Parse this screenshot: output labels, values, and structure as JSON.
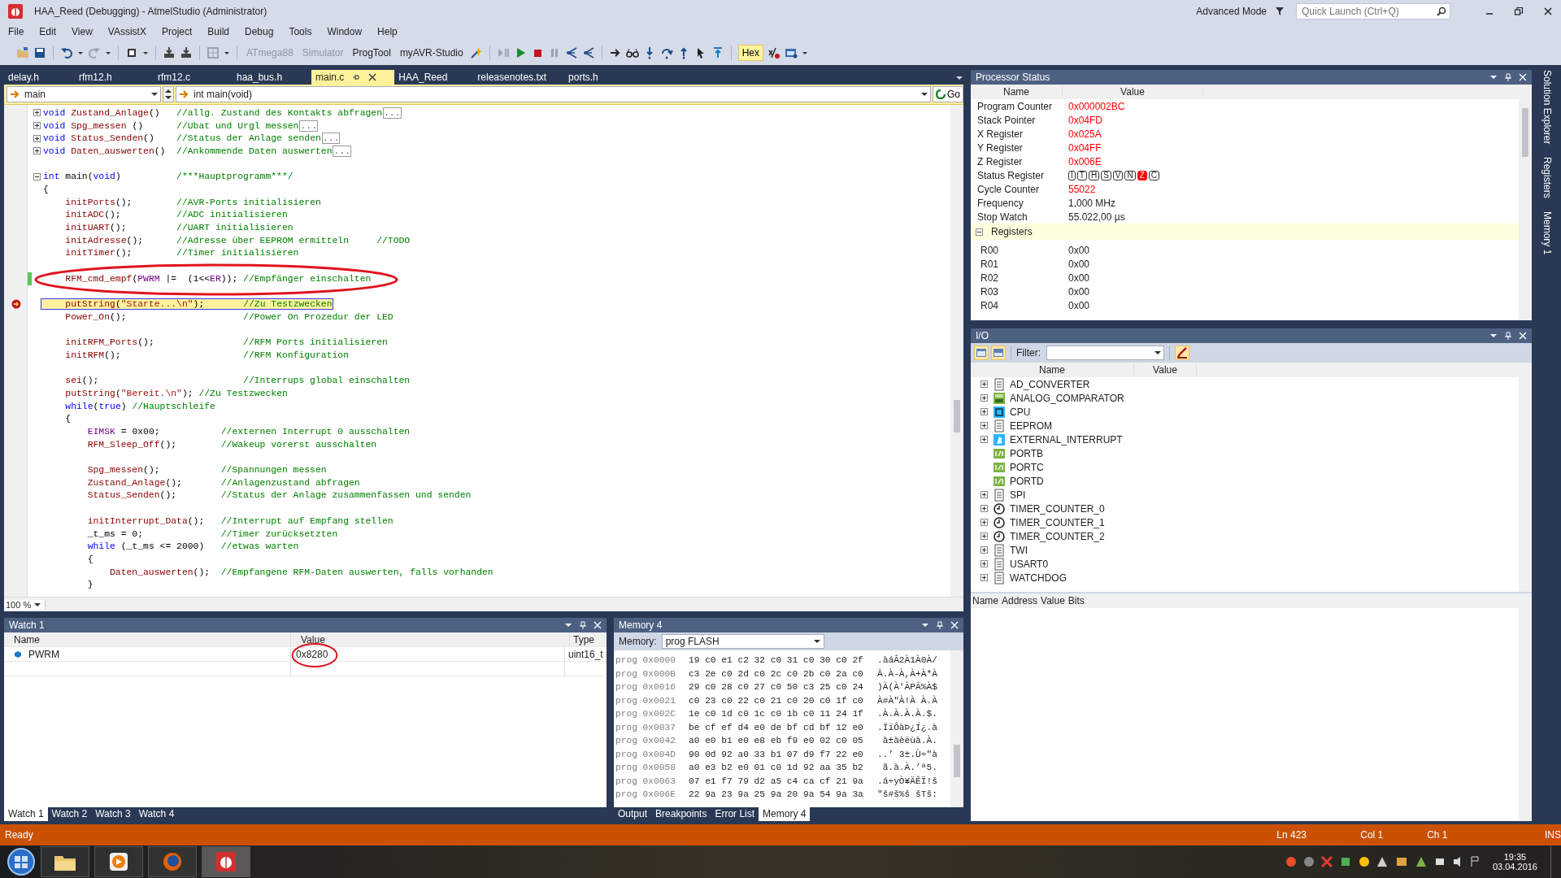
{
  "window": {
    "title": "HAA_Reed (Debugging) - AtmelStudio (Administrator)",
    "mode": "Advanced Mode",
    "quick_launch": {
      "placeholder": "Quick Launch (Ctrl+Q)"
    }
  },
  "menu": [
    "File",
    "Edit",
    "View",
    "VAssistX",
    "Project",
    "Build",
    "Debug",
    "Tools",
    "Window",
    "Help"
  ],
  "toolbar": [
    {
      "label": "ATmega88",
      "disabled": true
    },
    {
      "label": "Simulator",
      "disabled": true
    },
    {
      "label": "ProgTool",
      "disabled": false
    },
    {
      "label": "myAVR-Studio",
      "disabled": false
    }
  ],
  "hex_toggle": {
    "label": "Hex",
    "on": true
  },
  "editor": {
    "tabs": [
      {
        "label": "delay.h",
        "selected": false
      },
      {
        "label": "rfm12.h",
        "selected": false
      },
      {
        "label": "rfm12.c",
        "selected": false
      },
      {
        "label": "haa_bus.h",
        "selected": false
      },
      {
        "label": "main.c",
        "selected": true
      },
      {
        "label": "HAA_Reed",
        "selected": false
      },
      {
        "label": "releasenotes.txt",
        "selected": false
      },
      {
        "label": "ports.h",
        "selected": false
      }
    ],
    "scope": "main",
    "function": "int main(void)",
    "go": "Go",
    "zoom": "100 %",
    "lines": [
      {
        "kind": "collapsed",
        "tokens": [
          {
            "text": "void ",
            "kind": "keyword"
          },
          {
            "text": "Zustand_Anlage",
            "kind": "function"
          },
          {
            "text": "()   ",
            "kind": "plain"
          },
          {
            "text": "//allg. Zustand des Kontakts abfragen",
            "kind": "comment"
          },
          {
            "text": "...",
            "kind": "fold"
          }
        ]
      },
      {
        "kind": "collapsed",
        "tokens": [
          {
            "text": "void ",
            "kind": "keyword"
          },
          {
            "text": "Spg_messen",
            "kind": "function"
          },
          {
            "text": " ()      ",
            "kind": "plain"
          },
          {
            "text": "//Ubat und Urgl messen",
            "kind": "comment"
          },
          {
            "text": "...",
            "kind": "fold"
          }
        ]
      },
      {
        "kind": "collapsed",
        "tokens": [
          {
            "text": "void ",
            "kind": "keyword"
          },
          {
            "text": "Status_Senden",
            "kind": "function"
          },
          {
            "text": "()    ",
            "kind": "plain"
          },
          {
            "text": "//Status der Anlage senden",
            "kind": "comment"
          },
          {
            "text": "...",
            "kind": "fold"
          }
        ]
      },
      {
        "kind": "collapsed",
        "tokens": [
          {
            "text": "void ",
            "kind": "keyword"
          },
          {
            "text": "Daten_auswerten",
            "kind": "function"
          },
          {
            "text": "()  ",
            "kind": "plain"
          },
          {
            "text": "//Ankommende Daten auswerten",
            "kind": "comment"
          },
          {
            "text": "...",
            "kind": "fold"
          }
        ]
      },
      {
        "kind": "blank"
      },
      {
        "kind": "expanded",
        "tokens": [
          {
            "text": "int",
            "kind": "keyword"
          },
          {
            "text": " main(",
            "kind": "plain"
          },
          {
            "text": "void",
            "kind": "keyword"
          },
          {
            "text": ")          ",
            "kind": "plain"
          },
          {
            "text": "/***Hauptprogramm***/",
            "kind": "comment"
          }
        ]
      },
      {
        "kind": "code",
        "tokens": [
          {
            "text": "{",
            "kind": "plain"
          }
        ]
      },
      {
        "kind": "code",
        "tokens": [
          {
            "text": "    initPorts",
            "kind": "function"
          },
          {
            "text": "();        ",
            "kind": "plain"
          },
          {
            "text": "//AVR-Ports initialisieren",
            "kind": "comment"
          }
        ]
      },
      {
        "kind": "code",
        "tokens": [
          {
            "text": "    initADC",
            "kind": "function"
          },
          {
            "text": "();          ",
            "kind": "plain"
          },
          {
            "text": "//ADC initialisieren",
            "kind": "comment"
          }
        ]
      },
      {
        "kind": "code",
        "tokens": [
          {
            "text": "    initUART",
            "kind": "function"
          },
          {
            "text": "();         ",
            "kind": "plain"
          },
          {
            "text": "//UART initialisieren",
            "kind": "comment"
          }
        ]
      },
      {
        "kind": "code",
        "tokens": [
          {
            "text": "    initAdresse",
            "kind": "function"
          },
          {
            "text": "();      ",
            "kind": "plain"
          },
          {
            "text": "//Adresse über EEPROM ermitteln     //TODO",
            "kind": "comment"
          }
        ]
      },
      {
        "kind": "code",
        "tokens": [
          {
            "text": "    initTimer",
            "kind": "function"
          },
          {
            "text": "();        ",
            "kind": "plain"
          },
          {
            "text": "//Timer initialisieren",
            "kind": "comment"
          }
        ]
      },
      {
        "kind": "blank"
      },
      {
        "kind": "changed",
        "tokens": [
          {
            "text": "    RFM_cmd_empf",
            "kind": "function"
          },
          {
            "text": "(",
            "kind": "plain"
          },
          {
            "text": "PWRM",
            "kind": "macro"
          },
          {
            "text": " |=  (1<<",
            "kind": "plain"
          },
          {
            "text": "ER",
            "kind": "macro"
          },
          {
            "text": ")); ",
            "kind": "plain"
          },
          {
            "text": "//Empfänger einschalten",
            "kind": "comment"
          }
        ]
      },
      {
        "kind": "blank"
      },
      {
        "kind": "current",
        "tokens": [
          {
            "text": "    putString",
            "kind": "function"
          },
          {
            "text": "(",
            "kind": "plain"
          },
          {
            "text": "\"Starte...\\n\"",
            "kind": "string"
          },
          {
            "text": ");       ",
            "kind": "plain"
          },
          {
            "text": "//Zu Testzwecken",
            "kind": "comment"
          }
        ]
      },
      {
        "kind": "code",
        "tokens": [
          {
            "text": "    Power_On",
            "kind": "function"
          },
          {
            "text": "();                     ",
            "kind": "plain"
          },
          {
            "text": "//Power On Prozedur der LED",
            "kind": "comment"
          }
        ]
      },
      {
        "kind": "blank"
      },
      {
        "kind": "code",
        "tokens": [
          {
            "text": "    initRFM_Ports",
            "kind": "function"
          },
          {
            "text": "();                ",
            "kind": "plain"
          },
          {
            "text": "//RFM Ports initialisieren",
            "kind": "comment"
          }
        ]
      },
      {
        "kind": "code",
        "tokens": [
          {
            "text": "    initRFM",
            "kind": "function"
          },
          {
            "text": "();                      ",
            "kind": "plain"
          },
          {
            "text": "//RFM Konfiguration",
            "kind": "comment"
          }
        ]
      },
      {
        "kind": "blank"
      },
      {
        "kind": "code",
        "tokens": [
          {
            "text": "    sei",
            "kind": "function"
          },
          {
            "text": "();                          ",
            "kind": "plain"
          },
          {
            "text": "//Interrups global einschalten",
            "kind": "comment"
          }
        ]
      },
      {
        "kind": "code",
        "tokens": [
          {
            "text": "    putString",
            "kind": "function"
          },
          {
            "text": "(",
            "kind": "plain"
          },
          {
            "text": "\"Bereit.\\n\"",
            "kind": "string"
          },
          {
            "text": "); ",
            "kind": "plain"
          },
          {
            "text": "//Zu Testzwecken",
            "kind": "comment"
          }
        ]
      },
      {
        "kind": "code",
        "tokens": [
          {
            "text": "    while",
            "kind": "keyword"
          },
          {
            "text": "(",
            "kind": "plain"
          },
          {
            "text": "true",
            "kind": "keyword"
          },
          {
            "text": ") ",
            "kind": "plain"
          },
          {
            "text": "//Hauptschleife",
            "kind": "comment"
          }
        ]
      },
      {
        "kind": "code",
        "tokens": [
          {
            "text": "    {",
            "kind": "plain"
          }
        ]
      },
      {
        "kind": "code",
        "tokens": [
          {
            "text": "        EIMSK",
            "kind": "macro"
          },
          {
            "text": " = 0x00;           ",
            "kind": "plain"
          },
          {
            "text": "//externen Interrupt 0 ausschalten",
            "kind": "comment"
          }
        ]
      },
      {
        "kind": "code",
        "tokens": [
          {
            "text": "        RFM_Sleep_Off",
            "kind": "function"
          },
          {
            "text": "();        ",
            "kind": "plain"
          },
          {
            "text": "//Wakeup vorerst ausschalten",
            "kind": "comment"
          }
        ]
      },
      {
        "kind": "blank"
      },
      {
        "kind": "code",
        "tokens": [
          {
            "text": "        Spg_messen",
            "kind": "function"
          },
          {
            "text": "();           ",
            "kind": "plain"
          },
          {
            "text": "//Spannungen messen",
            "kind": "comment"
          }
        ]
      },
      {
        "kind": "code",
        "tokens": [
          {
            "text": "        Zustand_Anlage",
            "kind": "function"
          },
          {
            "text": "();       ",
            "kind": "plain"
          },
          {
            "text": "//Anlagenzustand abfragen",
            "kind": "comment"
          }
        ]
      },
      {
        "kind": "code",
        "tokens": [
          {
            "text": "        Status_Senden",
            "kind": "function"
          },
          {
            "text": "();        ",
            "kind": "plain"
          },
          {
            "text": "//Status der Anlage zusammenfassen und senden",
            "kind": "comment"
          }
        ]
      },
      {
        "kind": "blank"
      },
      {
        "kind": "code",
        "tokens": [
          {
            "text": "        initInterrupt_Data",
            "kind": "function"
          },
          {
            "text": "();   ",
            "kind": "plain"
          },
          {
            "text": "//Interrupt auf Empfang stellen",
            "kind": "comment"
          }
        ]
      },
      {
        "kind": "code",
        "tokens": [
          {
            "text": "        _t_ms = 0;              ",
            "kind": "plain"
          },
          {
            "text": "//Timer zurücksetzten",
            "kind": "comment"
          }
        ]
      },
      {
        "kind": "code",
        "tokens": [
          {
            "text": "        while",
            "kind": "keyword"
          },
          {
            "text": " (_t_ms <= 2000)   ",
            "kind": "plain"
          },
          {
            "text": "//etwas warten",
            "kind": "comment"
          }
        ]
      },
      {
        "kind": "code",
        "tokens": [
          {
            "text": "        {",
            "kind": "plain"
          }
        ]
      },
      {
        "kind": "code",
        "tokens": [
          {
            "text": "            Daten_auswerten",
            "kind": "function"
          },
          {
            "text": "();  ",
            "kind": "plain"
          },
          {
            "text": "//Empfangene RFM-Daten auswerten, falls vorhanden",
            "kind": "comment"
          }
        ]
      },
      {
        "kind": "code",
        "tokens": [
          {
            "text": "        }",
            "kind": "plain"
          }
        ]
      }
    ]
  },
  "processor_status": {
    "title": "Processor Status",
    "columns": [
      "Name",
      "Value"
    ],
    "rows": [
      {
        "kind": "value",
        "name": "Program Counter",
        "value": "0x000002BC",
        "changed": true
      },
      {
        "kind": "value",
        "name": "Stack Pointer",
        "value": "0x04FD",
        "changed": true
      },
      {
        "kind": "value",
        "name": "X Register",
        "value": "0x025A",
        "changed": true
      },
      {
        "kind": "value",
        "name": "Y Register",
        "value": "0x04FF",
        "changed": true
      },
      {
        "kind": "value",
        "name": "Z Register",
        "value": "0x006E",
        "changed": true
      },
      {
        "kind": "flags",
        "name": "Status Register",
        "flags": [
          {
            "label": "I",
            "set": false
          },
          {
            "label": "T",
            "set": false
          },
          {
            "label": "H",
            "set": false
          },
          {
            "label": "S",
            "set": false
          },
          {
            "label": "V",
            "set": false
          },
          {
            "label": "N",
            "set": false
          },
          {
            "label": "Z",
            "set": true
          },
          {
            "label": "C",
            "set": false
          }
        ]
      },
      {
        "kind": "value",
        "name": "Cycle Counter",
        "value": "55022",
        "changed": true
      },
      {
        "kind": "value",
        "name": "Frequency",
        "value": "1,000 MHz",
        "changed": false
      },
      {
        "kind": "value",
        "name": "Stop Watch",
        "value": "55.022,00 µs",
        "changed": false
      }
    ],
    "registers": {
      "label": "Registers",
      "expanded": true,
      "items": [
        {
          "name": "R00",
          "value": "0x00"
        },
        {
          "name": "R01",
          "value": "0x00"
        },
        {
          "name": "R02",
          "value": "0x00"
        },
        {
          "name": "R03",
          "value": "0x00"
        },
        {
          "name": "R04",
          "value": "0x00"
        }
      ]
    }
  },
  "io": {
    "title": "I/O",
    "filter_label": "Filter:",
    "columns": [
      "Name",
      "Value"
    ],
    "items": [
      {
        "label": "AD_CONVERTER",
        "kind": "document",
        "expandable": true
      },
      {
        "label": "ANALOG_COMPARATOR",
        "kind": "analog",
        "expandable": true
      },
      {
        "label": "CPU",
        "kind": "cpu",
        "expandable": true
      },
      {
        "label": "EEPROM",
        "kind": "document",
        "expandable": true
      },
      {
        "label": "EXTERNAL_INTERRUPT",
        "kind": "interrupt",
        "expandable": true
      },
      {
        "label": "PORTB",
        "kind": "port",
        "expandable": false
      },
      {
        "label": "PORTC",
        "kind": "port",
        "expandable": false
      },
      {
        "label": "PORTD",
        "kind": "port",
        "expandable": false
      },
      {
        "label": "SPI",
        "kind": "document",
        "expandable": true
      },
      {
        "label": "TIMER_COUNTER_0",
        "kind": "timer",
        "expandable": true
      },
      {
        "label": "TIMER_COUNTER_1",
        "kind": "timer",
        "expandable": true
      },
      {
        "label": "TIMER_COUNTER_2",
        "kind": "timer",
        "expandable": true
      },
      {
        "label": "TWI",
        "kind": "document",
        "expandable": true
      },
      {
        "label": "USART0",
        "kind": "document",
        "expandable": true
      },
      {
        "label": "WATCHDOG",
        "kind": "document",
        "expandable": true
      }
    ],
    "detail_columns": [
      "Name",
      "Address",
      "Value",
      "Bits"
    ]
  },
  "side_tabs": [
    "Solution Explorer",
    "Registers",
    "Memory 1"
  ],
  "watch": {
    "title": "Watch 1",
    "columns": [
      "Name",
      "Value",
      "Type"
    ],
    "rows": [
      {
        "name": "PWRM",
        "value": "0x8280",
        "type": "uint16_t",
        "circled": true
      }
    ],
    "tabs": [
      {
        "label": "Watch 1",
        "selected": true
      },
      {
        "label": "Watch 2",
        "selected": false
      },
      {
        "label": "Watch 3",
        "selected": false
      },
      {
        "label": "Watch 4",
        "selected": false
      }
    ]
  },
  "memory": {
    "title": "Memory 4",
    "memory_label": "Memory:",
    "memory_value": "prog FLASH",
    "rows": [
      {
        "addr": "prog 0x0000",
        "hex": "19 c0 e1 c2 32 c0 31 c0 30 c0 2f",
        "ascii": ".àáÂ2À1À0À/"
      },
      {
        "addr": "prog 0x000B",
        "hex": "c3 2e c0 2d c0 2c c0 2b c0 2a c0",
        "ascii": "Ã.À-À,À+À*À"
      },
      {
        "addr": "prog 0x0016",
        "hex": "29 c0 28 c0 27 c0 50 c3 25 c0 24",
        "ascii": ")À(À'ÀPÃ%À$"
      },
      {
        "addr": "prog 0x0021",
        "hex": "c0 23 c0 22 c0 21 c0 20 c0 1f c0",
        "ascii": "À#À\"À!À À.À"
      },
      {
        "addr": "prog 0x002C",
        "hex": "1e c0 1d c0 1c c0 1b c0 11 24 1f",
        "ascii": ".À.À.À.À.$."
      },
      {
        "addr": "prog 0x0037",
        "hex": "be cf ef d4 e0 de bf cd bf 12 e0",
        "ascii": ".ÏïÔàÞ¿Í¿.à"
      },
      {
        "addr": "prog 0x0042",
        "hex": "a0 e0 b1 e0 e8 eb f9 e0 02 c0 05",
        "ascii": " à±àèëùà.À."
      },
      {
        "addr": "prog 0x004D",
        "hex": "90 0d 92 a0 33 b1 07 d9 f7 22 e0",
        "ascii": "..’ 3±.Ù÷\"à"
      },
      {
        "addr": "prog 0x0058",
        "hex": "a0 e3 b2 e0 01 c0 1d 92 aa 35 b2",
        "ascii": " ã.à.À.’ª5."
      },
      {
        "addr": "prog 0x0063",
        "hex": "07 e1 f7 79 d2 a5 c4 ca cf 21 9a",
        "ascii": ".á÷yÒ¥ÄÊÏ!š"
      },
      {
        "addr": "prog 0x006E",
        "hex": "22 9a 23 9a 25 9a 20 9a 54 9a 3a",
        "ascii": "\"š#š%š šTš:"
      }
    ],
    "tabs": [
      {
        "label": "Output",
        "selected": false
      },
      {
        "label": "Breakpoints",
        "selected": false
      },
      {
        "label": "Error List",
        "selected": false
      },
      {
        "label": "Memory 4",
        "selected": true
      }
    ]
  },
  "status_bar": {
    "message": "Ready",
    "line": "Ln 423",
    "column": "Col 1",
    "char": "Ch 1",
    "mode": "INS"
  },
  "taskbar": {
    "time": "19:35",
    "date": "03.04.2016"
  }
}
